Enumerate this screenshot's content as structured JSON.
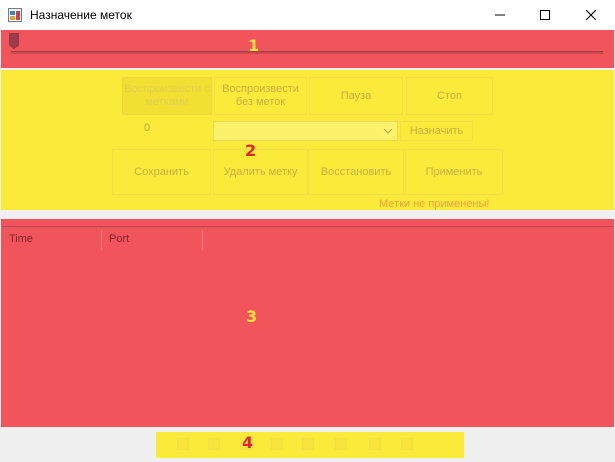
{
  "window": {
    "title": "Назначение меток"
  },
  "zones": {
    "z1": "1",
    "z2": "2",
    "z3": "3",
    "z4": "4"
  },
  "controls": {
    "play_with_marks": "Воспроизвести с метками",
    "play_without_marks": "Воспроизвести без меток",
    "pause": "Пауза",
    "stop": "Стоп",
    "counter_value": "0",
    "assign": "Назначить",
    "save": "Сохранить",
    "delete_mark": "Удалить метку",
    "restore": "Восстановить",
    "apply": "Применить",
    "status": "Метки не применены!"
  },
  "table": {
    "columns": [
      "Time",
      "Port"
    ]
  },
  "colors": {
    "red_zone": "#f2545b",
    "yellow_zone": "#faeb3a",
    "status": "#f0a040"
  },
  "icons": [
    "app-icon",
    "minimize-icon",
    "maximize-icon",
    "close-icon",
    "chevron-down-icon",
    "slider-thumb-icon"
  ]
}
